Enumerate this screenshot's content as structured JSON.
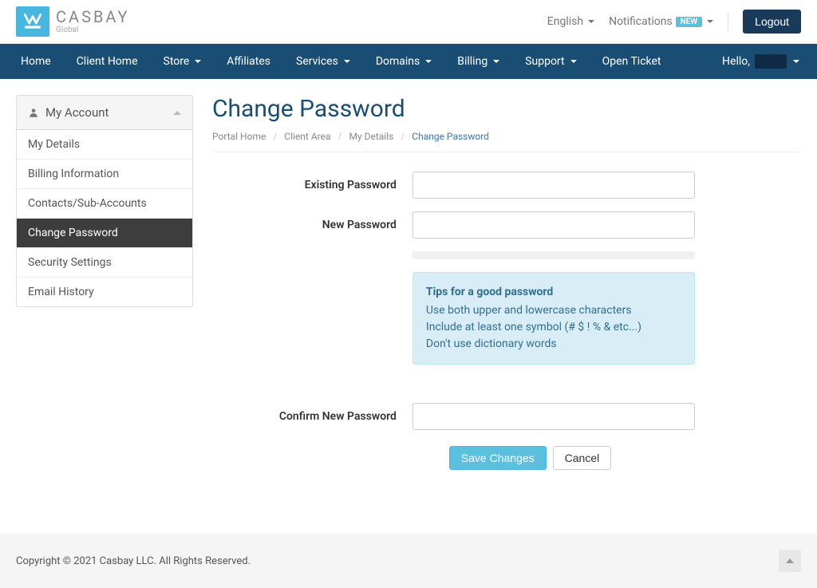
{
  "header": {
    "brand_name": "CASBAY",
    "brand_sub": "Global",
    "language": "English",
    "notifications_label": "Notifications",
    "notifications_badge": "NEW",
    "logout_label": "Logout"
  },
  "nav": {
    "items": [
      {
        "label": "Home",
        "has_caret": false
      },
      {
        "label": "Client Home",
        "has_caret": false
      },
      {
        "label": "Store",
        "has_caret": true
      },
      {
        "label": "Affiliates",
        "has_caret": false
      },
      {
        "label": "Services",
        "has_caret": true
      },
      {
        "label": "Domains",
        "has_caret": true
      },
      {
        "label": "Billing",
        "has_caret": true
      },
      {
        "label": "Support",
        "has_caret": true
      },
      {
        "label": "Open Ticket",
        "has_caret": false
      }
    ],
    "greeting": "Hello,"
  },
  "sidebar": {
    "heading": "My Account",
    "items": [
      {
        "label": "My Details",
        "active": false
      },
      {
        "label": "Billing Information",
        "active": false
      },
      {
        "label": "Contacts/Sub-Accounts",
        "active": false
      },
      {
        "label": "Change Password",
        "active": true
      },
      {
        "label": "Security Settings",
        "active": false
      },
      {
        "label": "Email History",
        "active": false
      }
    ]
  },
  "page": {
    "title": "Change Password",
    "breadcrumb": [
      {
        "label": "Portal Home",
        "active": false
      },
      {
        "label": "Client Area",
        "active": false
      },
      {
        "label": "My Details",
        "active": false
      },
      {
        "label": "Change Password",
        "active": true
      }
    ]
  },
  "form": {
    "existing_label": "Existing Password",
    "new_label": "New Password",
    "confirm_label": "Confirm New Password",
    "tips": {
      "title": "Tips for a good password",
      "line1": "Use both upper and lowercase characters",
      "line2": "Include at least one symbol (# $ ! % & etc...)",
      "line3": "Don't use dictionary words"
    },
    "save_label": "Save Changes",
    "cancel_label": "Cancel"
  },
  "footer": {
    "copyright": "Copyright © 2021 Casbay LLC. All Rights Reserved."
  }
}
